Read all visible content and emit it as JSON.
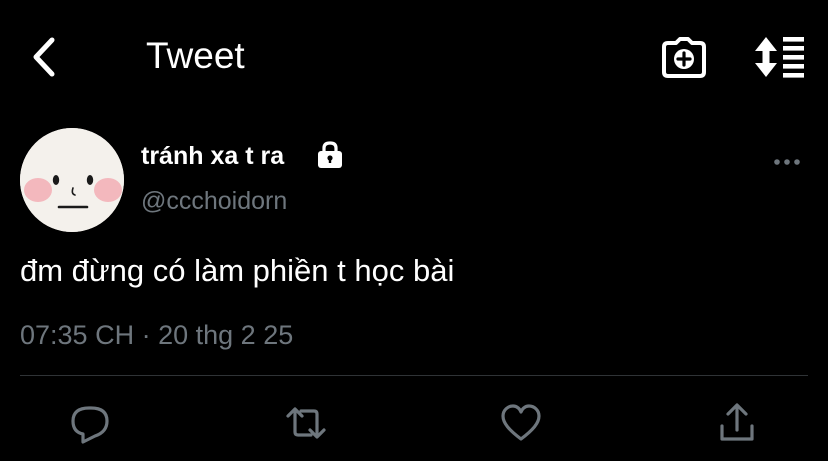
{
  "header": {
    "title": "Tweet",
    "back_icon": "chevron-left-icon",
    "camera_icon": "camera-plus-icon",
    "sort_icon": "sort-list-icon"
  },
  "author": {
    "display_name": "tránh xa t ra",
    "handle": "@ccchoidorn",
    "protected_icon": "lock-icon",
    "more_icon": "more-horizontal-icon"
  },
  "tweet": {
    "text": "đm đừng có làm phiền t học bài",
    "time": "07:35 CH",
    "separator": "·",
    "date": "20 thg 2 25"
  },
  "actions": {
    "reply_icon": "reply-icon",
    "retweet_icon": "retweet-icon",
    "like_icon": "heart-icon",
    "share_icon": "share-icon"
  },
  "colors": {
    "background": "#000000",
    "primary_text": "#ffffff",
    "secondary_text": "#6e767d",
    "divider": "#2f3336",
    "avatar_bg": "#f4f1ec",
    "avatar_cheek": "#f3b8bd"
  }
}
